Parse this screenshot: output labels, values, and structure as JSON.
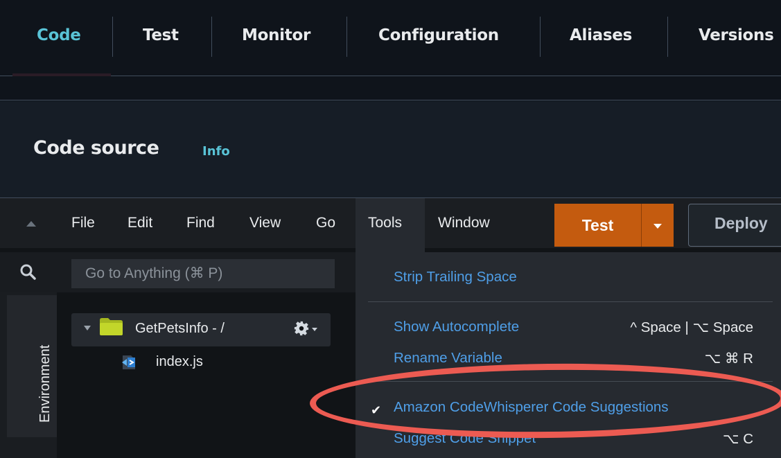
{
  "tabs": [
    {
      "label": "Code",
      "active": true
    },
    {
      "label": "Test",
      "active": false
    },
    {
      "label": "Monitor",
      "active": false
    },
    {
      "label": "Configuration",
      "active": false
    },
    {
      "label": "Aliases",
      "active": false
    },
    {
      "label": "Versions",
      "active": false
    }
  ],
  "panel": {
    "title": "Code source",
    "info_link": "Info"
  },
  "menubar": {
    "items": [
      "File",
      "Edit",
      "Find",
      "View",
      "Go",
      "Tools",
      "Window"
    ],
    "test_label": "Test",
    "deploy_label": "Deploy"
  },
  "search": {
    "placeholder": "Go to Anything (⌘ P)"
  },
  "sidebar": {
    "environment_label": "Environment"
  },
  "tree": {
    "folder_label": "GetPetsInfo - /",
    "file_label": "index.js"
  },
  "tools_menu": {
    "items": [
      {
        "label": "Strip Trailing Space",
        "shortcut": ""
      },
      {
        "label": "Show Autocomplete",
        "shortcut": "^ Space | ⌥ Space"
      },
      {
        "label": "Rename Variable",
        "shortcut": "⌥ ⌘ R"
      },
      {
        "label": "Amazon CodeWhisperer Code Suggestions",
        "shortcut": "",
        "checked": true
      },
      {
        "label": "Suggest Code Snippet",
        "shortcut": "⌥ C"
      }
    ],
    "check_mark": "✔"
  },
  "colors": {
    "active_tab": "#59c3d6",
    "test_button": "#c45b0f",
    "menu_link": "#4f9fe8",
    "highlight": "#ec5b52"
  }
}
